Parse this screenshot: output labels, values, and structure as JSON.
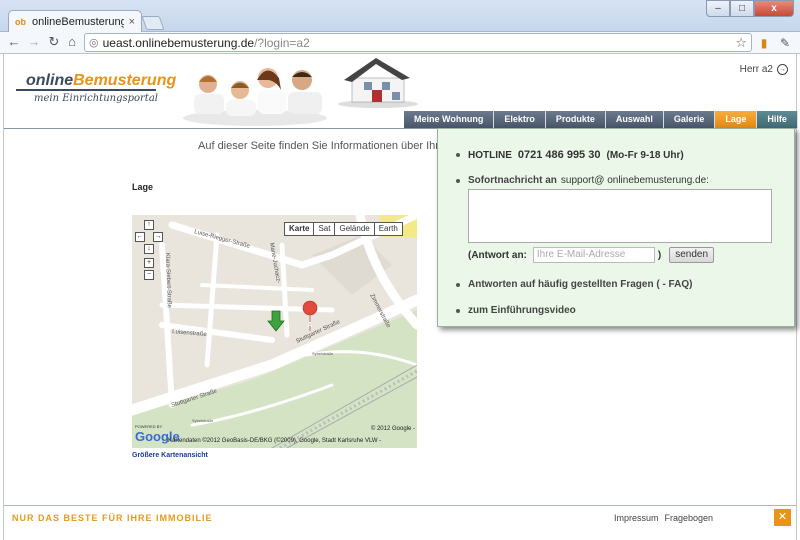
{
  "browser": {
    "tab_title": "onlineBemusterung",
    "tab_close": "×",
    "url_host": "ueast.onlinebemusterung.de",
    "url_path": "/?login=a2",
    "window_buttons": {
      "minimize": "–",
      "maximize": "□",
      "close": "x"
    }
  },
  "header": {
    "logo_prefix": "online",
    "logo_accent": "Bemusterung",
    "logo_subtitle": "mein Einrichtungsportal",
    "user_label": "Herr a2"
  },
  "nav": {
    "items": [
      {
        "label": "Meine Wohnung"
      },
      {
        "label": "Elektro"
      },
      {
        "label": "Produkte"
      },
      {
        "label": "Auswahl"
      },
      {
        "label": "Galerie"
      },
      {
        "label": "Lage"
      },
      {
        "label": "Hilfe"
      }
    ],
    "active": "Lage"
  },
  "content": {
    "intro": "Auf dieser Seite finden Sie Informationen über Ihr",
    "section_title": "Lage",
    "map_link": "Größere Kartenansicht"
  },
  "map": {
    "types": [
      "Karte",
      "Sat",
      "Gelände",
      "Earth"
    ],
    "selected_type": "Karte",
    "streets": [
      "Luise-Riegger-Straße",
      "Marie-Juchacz-",
      "Klara-Siebert-Straße",
      "Luisenstraße",
      "Stuttgarter Straße",
      "Stuttgarter Straße",
      "Zimmerstraße",
      "Sybelstraße",
      "Sybelstraße"
    ],
    "marker_label": "A",
    "copyright": "© 2012 Google -",
    "attribution": "Kartendaten ©2012 GeoBasis-DE/BKG (©2009), Google, Stadt Karlsruhe VLW -",
    "powered_by": "POWERED BY",
    "google": "Google"
  },
  "popup": {
    "hotline_label": "HOTLINE",
    "hotline_number": "0721 486 995 30",
    "hotline_hours": "(Mo-Fr 9-18 Uhr)",
    "message_label": "Sofortnachricht an",
    "message_email": "support@ onlinebemusterung.de:",
    "answer_label": "(Antwort an:",
    "answer_placeholder": "Ihre E-Mail-Adresse",
    "answer_close": ")",
    "send_label": "senden",
    "faq_label": "Antworten auf häufig gestellten Fragen (   - FAQ)",
    "video_label": "zum Einführungsvideo"
  },
  "footer": {
    "slogan": "NUR DAS BESTE FÜR IHRE IMMOBILIE",
    "links": [
      "Impressum",
      "Fragebogen"
    ]
  },
  "colors": {
    "accent": "#e89418",
    "nav_bg": "#485669",
    "popup_bg": "#ebf7e9"
  }
}
